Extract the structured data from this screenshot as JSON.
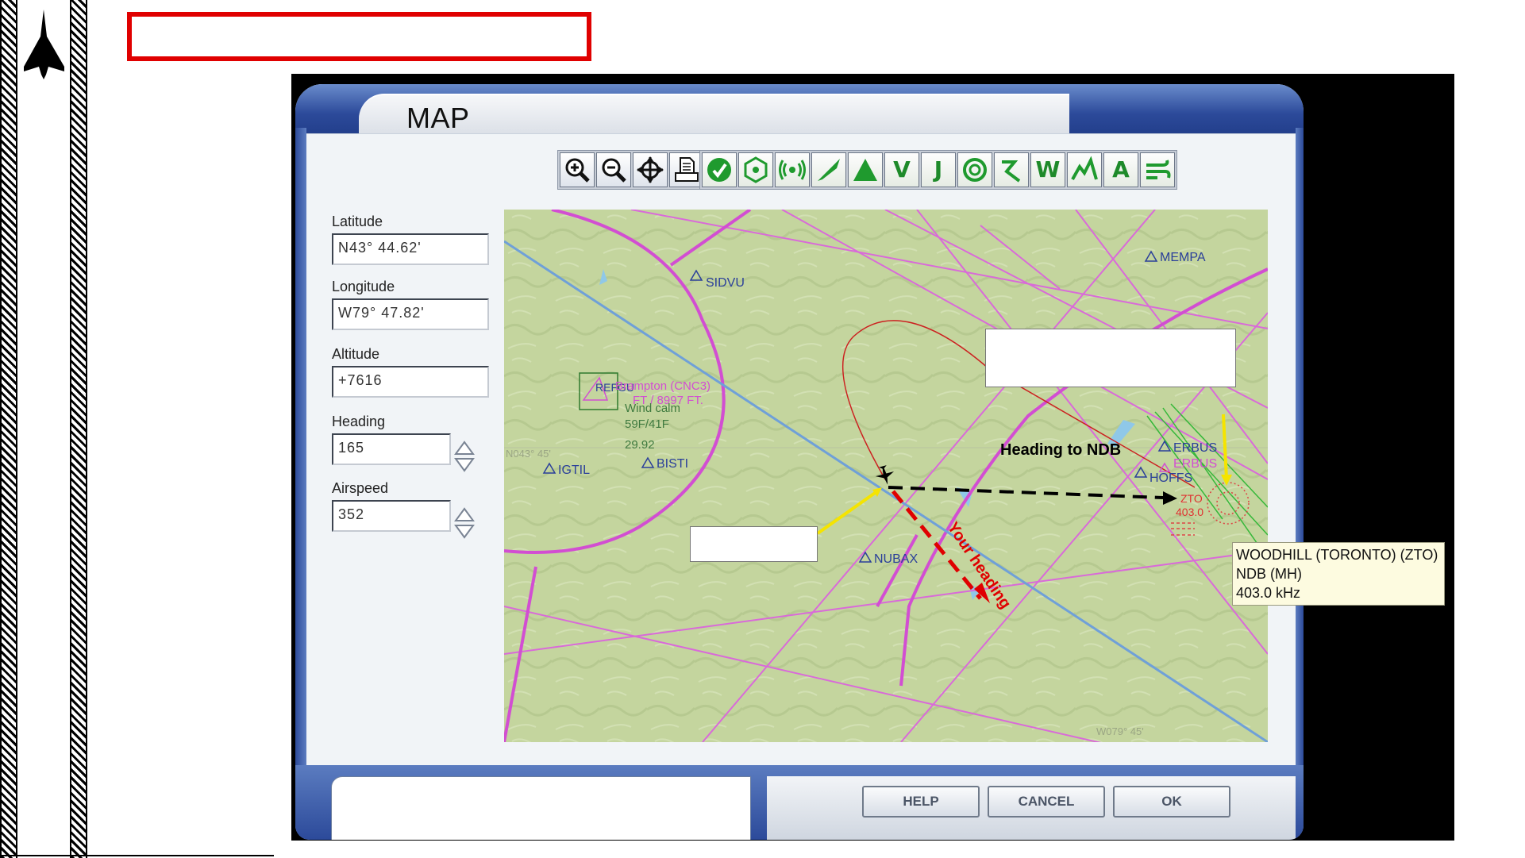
{
  "dialog": {
    "title": "MAP"
  },
  "toolbar": {
    "view_tools": [
      "zoom-in-icon",
      "zoom-out-icon",
      "center-icon",
      "print-icon"
    ],
    "layer_toggles": [
      "vor-icon",
      "ndb-icon",
      "ils-icon",
      "airport-runway-icon",
      "intersection-icon",
      "V",
      "J",
      "airspace-icon",
      "route-icon",
      "W",
      "terrain-icon",
      "A",
      "wind-icon"
    ]
  },
  "fields": {
    "latitude": {
      "label": "Latitude",
      "value": "N43° 44.62'"
    },
    "longitude": {
      "label": "Longitude",
      "value": "W79° 47.82'"
    },
    "altitude": {
      "label": "Altitude",
      "value": "+7616"
    },
    "heading": {
      "label": "Heading",
      "value": "165"
    },
    "airspeed": {
      "label": "Airspeed",
      "value": "352"
    }
  },
  "map": {
    "waypoints": {
      "sidvu": "SIDVU",
      "mempa": "MEMPA",
      "igtil": "IGTIL",
      "bisti": "BISTI",
      "nubax": "NUBAX",
      "erbus": "ERBUS",
      "erbus2": "ERBUS",
      "hoffs": "HOFFS",
      "refgu": "REFGU"
    },
    "airport_label": "Brampton (CNC3)",
    "airport_ident": "CNC3",
    "airport_elev": "FT / 8997 FT.",
    "wind": "Wind calm",
    "temp": "59F/41F",
    "pressure": "29.92",
    "lat_grid": "N043° 45'",
    "lon_grid": "W079° 45'",
    "ndb_ident": "ZTO",
    "ndb_freq": "403.0",
    "heading_to_ndb": "Heading to NDB",
    "your_heading": "Your heading"
  },
  "tooltip": {
    "line1": "WOODHILL (TORONTO) (ZTO)",
    "line2": "NDB (MH)",
    "line3": "403.0 kHz"
  },
  "buttons": {
    "help": "HELP",
    "cancel": "CANCEL",
    "ok": "OK"
  },
  "colors": {
    "annotation_frame": "#e00000",
    "map_terrain": "#c4d59e",
    "airway_magenta": "#d24ed2",
    "dialog_blue": "#2c4a9a",
    "heading_arrow": "#e00000",
    "callout_arrow": "#f5e400"
  }
}
